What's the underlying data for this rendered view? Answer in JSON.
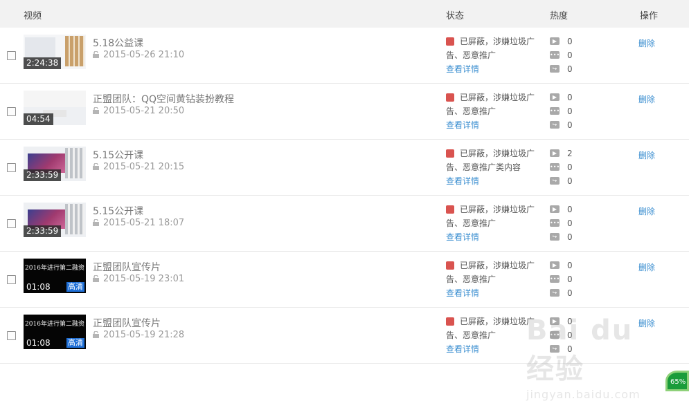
{
  "header": {
    "video": "视频",
    "status": "状态",
    "heat": "热度",
    "ops": "操作"
  },
  "rows": [
    {
      "title": "5.18公益课",
      "date": "2015-05-26 21:10",
      "duration": "2:24:38",
      "thumb": "screen",
      "status_text": "已屏蔽，涉嫌垃圾广告、恶意推广",
      "status_link": "查看详情",
      "plays": "0",
      "comments": "0",
      "shares": "0",
      "delete": "删除"
    },
    {
      "title": "正盟团队：QQ空间黄钻装扮教程",
      "date": "2015-05-21 20:50",
      "duration": "04:54",
      "thumb": "banner",
      "status_text": "已屏蔽，涉嫌垃圾广告、恶意推广",
      "status_link": "查看详情",
      "plays": "0",
      "comments": "0",
      "shares": "0",
      "delete": "删除"
    },
    {
      "title": "5.15公开课",
      "date": "2015-05-21 20:15",
      "duration": "2:33:59",
      "thumb": "photo",
      "status_text": "已屏蔽，涉嫌垃圾广告、恶意推广类内容",
      "status_link": "查看详情",
      "plays": "2",
      "comments": "0",
      "shares": "0",
      "delete": "删除"
    },
    {
      "title": "5.15公开课",
      "date": "2015-05-21 18:07",
      "duration": "2:33:59",
      "thumb": "photo",
      "status_text": "已屏蔽，涉嫌垃圾广告、恶意推广",
      "status_link": "查看详情",
      "plays": "0",
      "comments": "0",
      "shares": "0",
      "delete": "删除"
    },
    {
      "title": "正盟团队宣传片",
      "date": "2015-05-19 23:01",
      "duration": "01:08",
      "thumb": "dark",
      "caption": "2016年进行第二融资",
      "hd": "高清",
      "status_text": "已屏蔽，涉嫌垃圾广告、恶意推广",
      "status_link": "查看详情",
      "plays": "0",
      "comments": "0",
      "shares": "0",
      "delete": "删除"
    },
    {
      "title": "正盟团队宣传片",
      "date": "2015-05-19 21:28",
      "duration": "01:08",
      "thumb": "dark",
      "caption": "2016年进行第二融资",
      "hd": "高清",
      "status_text": "已屏蔽，涉嫌垃圾广告、恶意推广",
      "status_link": "查看详情",
      "plays": "0",
      "comments": "0",
      "shares": "0",
      "delete": "删除"
    }
  ],
  "watermark": {
    "logo": "Bai du 经验",
    "url": "jingyan.baidu.com"
  },
  "progress": {
    "value": 0.65,
    "label": "65%"
  },
  "colors": {
    "link": "#3a8ed0",
    "blocked": "#d9534f",
    "header_bg": "#f2f2f2",
    "hd_badge": "#1f6fd6"
  }
}
